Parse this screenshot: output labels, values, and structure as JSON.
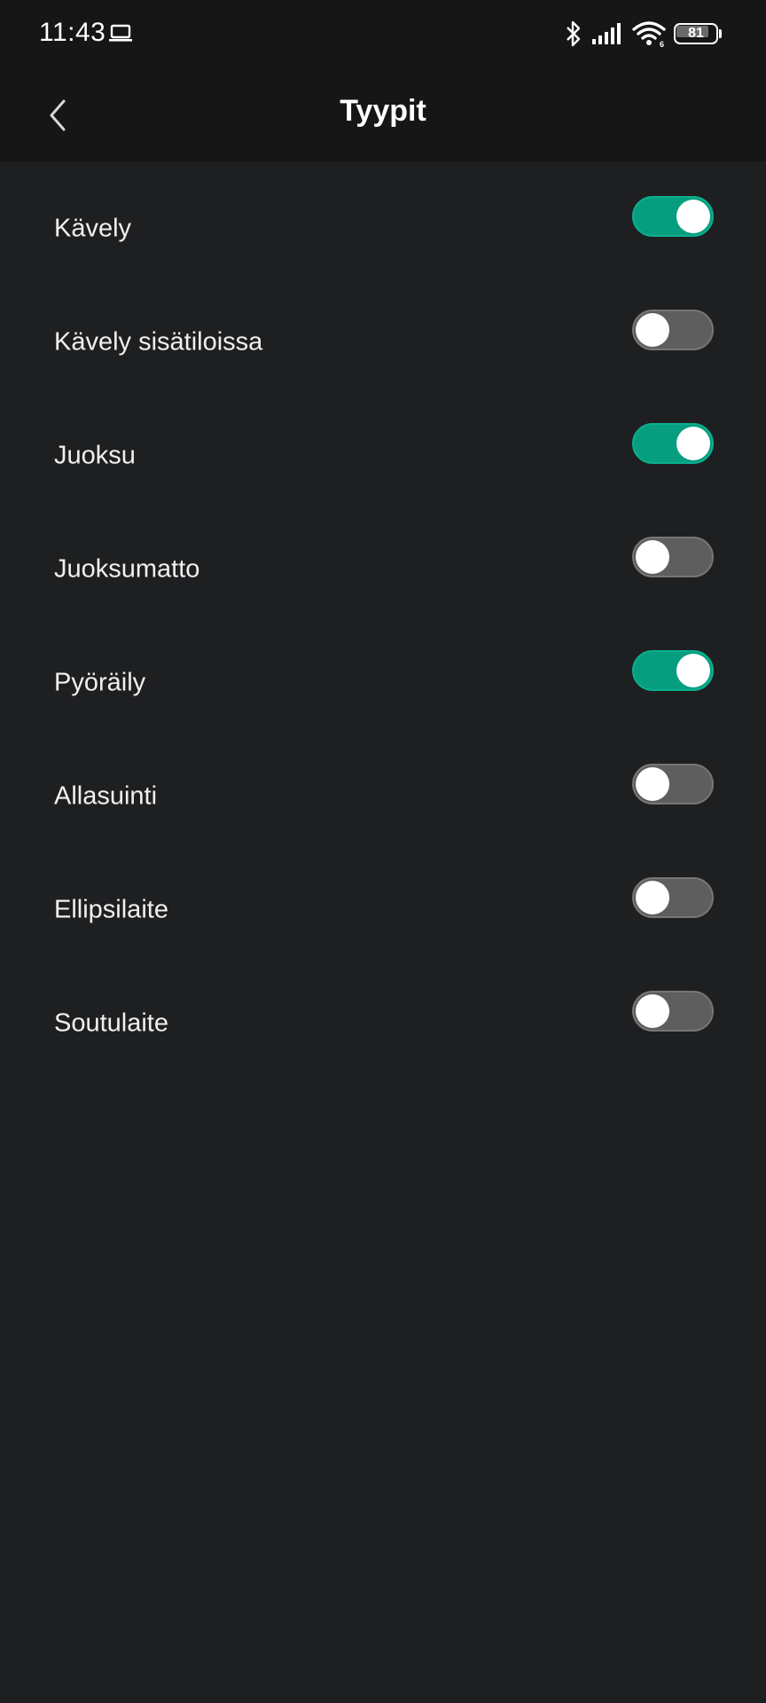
{
  "status_bar": {
    "time": "11:43",
    "battery_level": "81",
    "battery_fraction": 0.81,
    "icons": [
      "laptop-icon",
      "bluetooth-icon",
      "signal-icon",
      "wifi-icon",
      "battery-icon"
    ]
  },
  "header": {
    "title": "Tyypit",
    "back_icon": "chevron-left-icon"
  },
  "colors": {
    "toggle_on": "#079d7f",
    "toggle_off": "#5e5e5e",
    "background": "#1e1f21",
    "header_background": "#161616"
  },
  "items": [
    {
      "label": "Kävely",
      "enabled": true
    },
    {
      "label": "Kävely sisätiloissa",
      "enabled": false
    },
    {
      "label": "Juoksu",
      "enabled": true
    },
    {
      "label": "Juoksumatto",
      "enabled": false
    },
    {
      "label": "Pyöräily",
      "enabled": true
    },
    {
      "label": "Allasuinti",
      "enabled": false
    },
    {
      "label": "Ellipsilaite",
      "enabled": false
    },
    {
      "label": "Soutulaite",
      "enabled": false
    }
  ]
}
